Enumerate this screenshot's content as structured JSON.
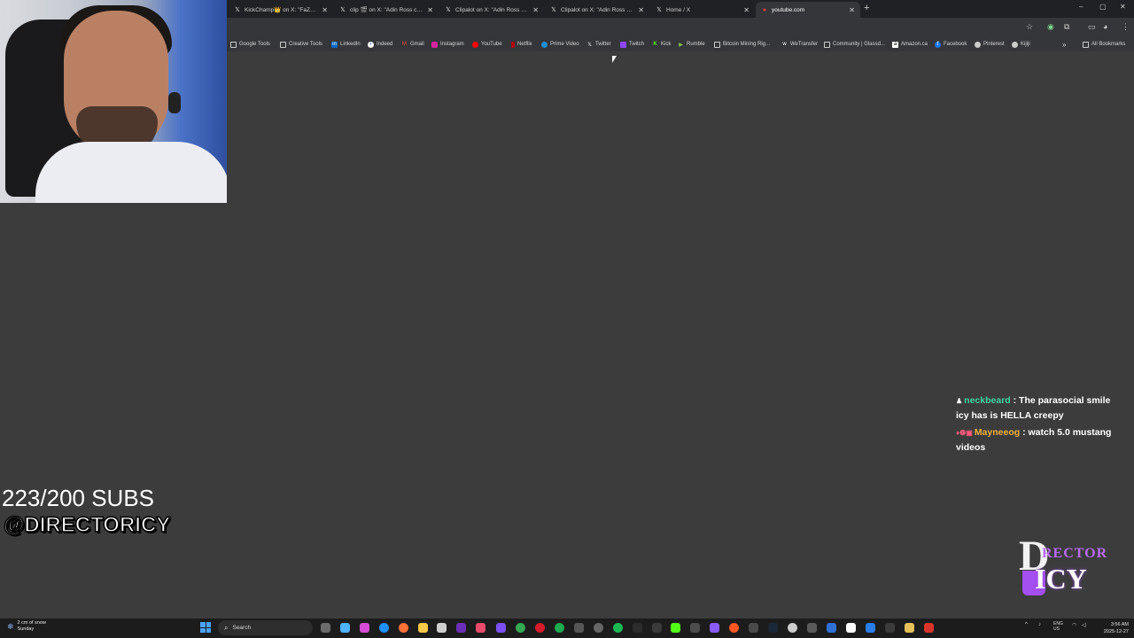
{
  "browser": {
    "tabs": [
      {
        "label": "KickChamp👑 on X: \"FaZe Banks",
        "icon": "x-logo-icon",
        "active": false
      },
      {
        "label": "clip 🎬 on X: \"Adin Ross calls h",
        "icon": "x-logo-icon",
        "active": false
      },
      {
        "label": "Clipalot on X: \"Adin Ross was S",
        "icon": "x-logo-icon",
        "active": false
      },
      {
        "label": "Clipalot on X: \"Adin Ross was S",
        "icon": "x-logo-icon",
        "active": false
      },
      {
        "label": "Home / X",
        "icon": "x-logo-icon",
        "active": false
      },
      {
        "label": "youtube.com",
        "icon": "youtube-icon",
        "active": true
      }
    ],
    "new_tab": "+",
    "window_controls": [
      "–",
      "▢",
      "✕"
    ],
    "bookmarks": [
      {
        "label": "Google Tools",
        "icon": "folder-icon"
      },
      {
        "label": "Creative Tools",
        "icon": "folder-icon"
      },
      {
        "label": "LinkedIn",
        "icon": "linkedin-icon"
      },
      {
        "label": "Indeed",
        "icon": "indeed-icon"
      },
      {
        "label": "Gmail",
        "icon": "gmail-icon"
      },
      {
        "label": "Instagram",
        "icon": "instagram-icon"
      },
      {
        "label": "YouTube",
        "icon": "youtube-icon"
      },
      {
        "label": "Netflix",
        "icon": "netflix-icon"
      },
      {
        "label": "Prime Video",
        "icon": "prime-video-icon"
      },
      {
        "label": "Twitter",
        "icon": "x-logo-icon"
      },
      {
        "label": "Twitch",
        "icon": "twitch-icon"
      },
      {
        "label": "Kick",
        "icon": "kick-icon"
      },
      {
        "label": "Rumble",
        "icon": "rumble-icon"
      },
      {
        "label": "Bitcoin Mining Rig...",
        "icon": "folder-icon"
      },
      {
        "label": "WeTransfer",
        "icon": "wetransfer-icon"
      },
      {
        "label": "Community | Glassd...",
        "icon": "glassdoor-icon"
      },
      {
        "label": "Amazon.ca",
        "icon": "amazon-icon"
      },
      {
        "label": "Facebook",
        "icon": "facebook-icon"
      },
      {
        "label": "Pinterest",
        "icon": "pinterest-icon"
      },
      {
        "label": "Kijiji",
        "icon": "kijiji-icon"
      }
    ],
    "more_bookmarks": "»",
    "all_bookmarks": "All Bookmarks"
  },
  "overlay": {
    "subs_goal": "223/200 SUBS",
    "handle": "@DIRECTORICY",
    "chat": [
      {
        "badges": "♟",
        "user": "neckbeard",
        "separator": " : ",
        "text": "The parasocial smile icy has is HELLA creepy"
      },
      {
        "badges": "♦❶▣",
        "user": "Mayneeog",
        "separator": " : ",
        "text": "watch 5.0 mustang videos"
      }
    ],
    "logo": {
      "letter_d": "D",
      "rector": "RECTOR",
      "icy": "ICY"
    }
  },
  "taskbar": {
    "weather_line1": "2 cm of snow",
    "weather_line2": "Sunday",
    "search_label": "Search",
    "lang_line1": "ENG",
    "lang_line2": "US",
    "time": "3:56 AM",
    "date": "2025-12-27"
  },
  "colors": {
    "chat_user_1": "#3fd4a3",
    "chat_user_2": "#f5b13b",
    "page_background": "#3c3c3c",
    "logo_accent": "#b96cf2"
  }
}
